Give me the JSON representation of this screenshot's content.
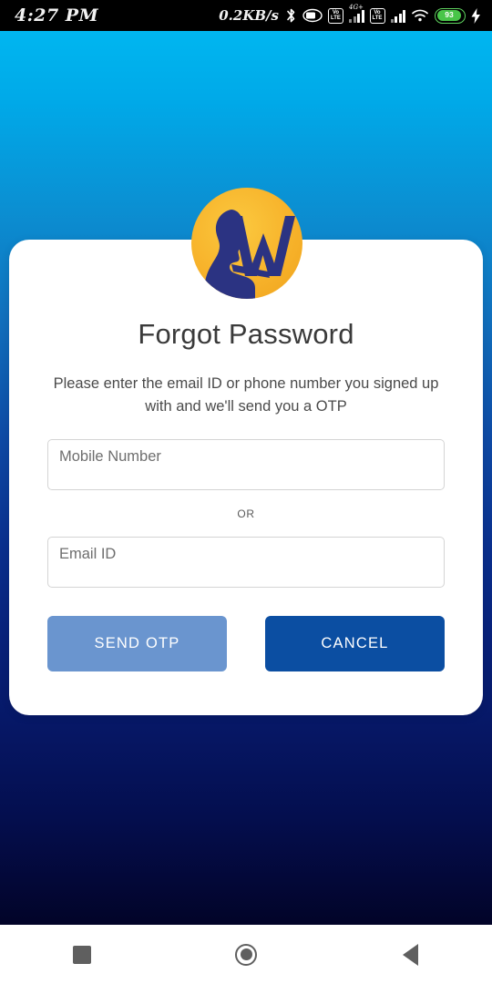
{
  "status_bar": {
    "time": "4:27 PM",
    "network_speed": "0.2KB/s",
    "bluetooth_icon": "bluetooth-icon",
    "alarm_icon": "alarm-icon",
    "volte_label_1": "VoLTE",
    "volte_label_2": "VoLTE",
    "network_type": "4G+",
    "wifi_icon": "wifi-icon",
    "battery_level": "93",
    "charging_icon": "charging-bolt-icon"
  },
  "logo": {
    "name": "app-logo",
    "letter": "W",
    "circle_color": "#f7b32b",
    "figure_color": "#2b3382"
  },
  "card": {
    "title": "Forgot Password",
    "subtitle": "Please enter the email ID or phone number you signed up with and we'll send you a OTP",
    "mobile_field": {
      "placeholder": "Mobile Number",
      "value": ""
    },
    "separator": "OR",
    "email_field": {
      "placeholder": "Email ID",
      "value": ""
    },
    "buttons": {
      "send_otp": "SEND OTP",
      "cancel": "CANCEL"
    }
  },
  "colors": {
    "send_otp_bg": "#6a95cf",
    "cancel_bg": "#0b4ea2",
    "bg_top": "#00b6f0",
    "bg_bottom": "#020428",
    "battery_green": "#49c549"
  },
  "nav_bar": {
    "recents": "recents-square-icon",
    "home": "home-circle-icon",
    "back": "back-triangle-icon"
  }
}
